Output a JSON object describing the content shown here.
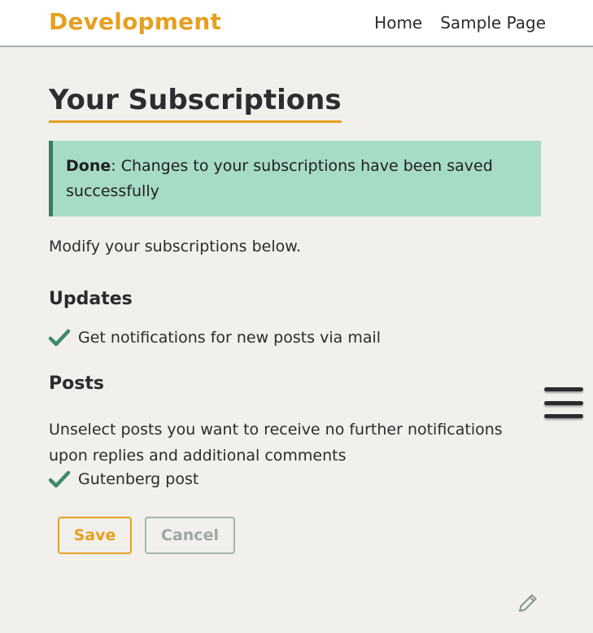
{
  "header": {
    "site_title": "Development",
    "nav": [
      "Home",
      "Sample Page"
    ]
  },
  "main": {
    "page_title": "Your Subscriptions",
    "notice": {
      "label": "Done",
      "message": ": Changes to your subscriptions have been saved successfully"
    },
    "intro": "Modify your subscriptions below.",
    "updates": {
      "heading": "Updates",
      "option": "Get notifications for new posts via mail",
      "checked": true
    },
    "posts": {
      "heading": "Posts",
      "description": "Unselect posts you want to receive no further notifications upon replies and additional comments",
      "items": [
        {
          "label": "Gutenberg post",
          "checked": true
        }
      ]
    },
    "buttons": {
      "save": "Save",
      "cancel": "Cancel"
    }
  },
  "icons": {
    "check": "check-icon",
    "menu": "hamburger-menu-icon",
    "edit": "pencil-icon"
  },
  "colors": {
    "accent": "#e6a021",
    "notice_bg": "#a6dbc5",
    "notice_border": "#3c7a62",
    "check": "#3c8a6a"
  }
}
